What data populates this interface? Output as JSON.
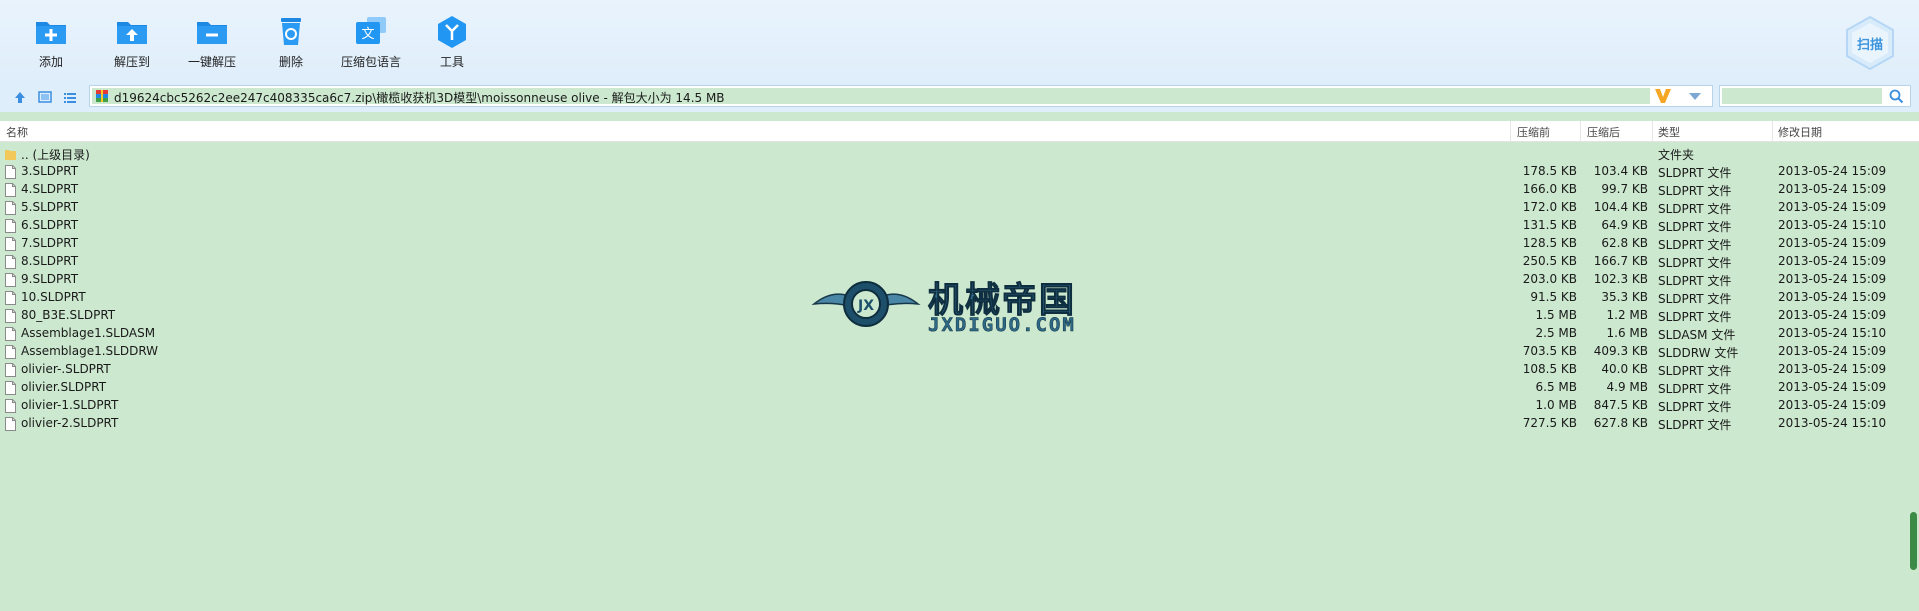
{
  "toolbar": {
    "add": "添加",
    "extract_to": "解压到",
    "one_click": "一键解压",
    "delete": "删除",
    "language": "压缩包语言",
    "tools": "工具",
    "scan": "扫描"
  },
  "address": {
    "path": "d19624cbc5262c2ee247c408335ca6c7.zip\\橄榄收获机3D模型\\moissonneuse olive - 解包大小为 14.5 MB"
  },
  "search": {
    "placeholder": ""
  },
  "columns": {
    "name": "名称",
    "before": "压缩前",
    "after": "压缩后",
    "type": "类型",
    "modified": "修改日期"
  },
  "files": [
    {
      "name": ".. (上级目录)",
      "before": "",
      "after": "",
      "type": "文件夹",
      "date": "",
      "folder": true
    },
    {
      "name": "3.SLDPRT",
      "before": "178.5 KB",
      "after": "103.4 KB",
      "type": "SLDPRT 文件",
      "date": "2013-05-24 15:09"
    },
    {
      "name": "4.SLDPRT",
      "before": "166.0 KB",
      "after": "99.7 KB",
      "type": "SLDPRT 文件",
      "date": "2013-05-24 15:09"
    },
    {
      "name": "5.SLDPRT",
      "before": "172.0 KB",
      "after": "104.4 KB",
      "type": "SLDPRT 文件",
      "date": "2013-05-24 15:09"
    },
    {
      "name": "6.SLDPRT",
      "before": "131.5 KB",
      "after": "64.9 KB",
      "type": "SLDPRT 文件",
      "date": "2013-05-24 15:10"
    },
    {
      "name": "7.SLDPRT",
      "before": "128.5 KB",
      "after": "62.8 KB",
      "type": "SLDPRT 文件",
      "date": "2013-05-24 15:09"
    },
    {
      "name": "8.SLDPRT",
      "before": "250.5 KB",
      "after": "166.7 KB",
      "type": "SLDPRT 文件",
      "date": "2013-05-24 15:09"
    },
    {
      "name": "9.SLDPRT",
      "before": "203.0 KB",
      "after": "102.3 KB",
      "type": "SLDPRT 文件",
      "date": "2013-05-24 15:09"
    },
    {
      "name": "10.SLDPRT",
      "before": "91.5 KB",
      "after": "35.3 KB",
      "type": "SLDPRT 文件",
      "date": "2013-05-24 15:09"
    },
    {
      "name": "80_B3E.SLDPRT",
      "before": "1.5 MB",
      "after": "1.2 MB",
      "type": "SLDPRT 文件",
      "date": "2013-05-24 15:09"
    },
    {
      "name": "Assemblage1.SLDASM",
      "before": "2.5 MB",
      "after": "1.6 MB",
      "type": "SLDASM 文件",
      "date": "2013-05-24 15:10"
    },
    {
      "name": "Assemblage1.SLDDRW",
      "before": "703.5 KB",
      "after": "409.3 KB",
      "type": "SLDDRW 文件",
      "date": "2013-05-24 15:09"
    },
    {
      "name": "olivier-.SLDPRT",
      "before": "108.5 KB",
      "after": "40.0 KB",
      "type": "SLDPRT 文件",
      "date": "2013-05-24 15:09"
    },
    {
      "name": "olivier.SLDPRT",
      "before": "6.5 MB",
      "after": "4.9 MB",
      "type": "SLDPRT 文件",
      "date": "2013-05-24 15:09"
    },
    {
      "name": "olivier-1.SLDPRT",
      "before": "1.0 MB",
      "after": "847.5 KB",
      "type": "SLDPRT 文件",
      "date": "2013-05-24 15:09"
    },
    {
      "name": "olivier-2.SLDPRT",
      "before": "727.5 KB",
      "after": "627.8 KB",
      "type": "SLDPRT 文件",
      "date": "2013-05-24 15:10"
    }
  ],
  "watermark": {
    "cn": "机械帝国",
    "en": "JXDIGUO.COM"
  },
  "colors": {
    "accent": "#2196f3",
    "list_bg": "#cce8cf",
    "toolbar_bg": "#e4f0fb"
  }
}
